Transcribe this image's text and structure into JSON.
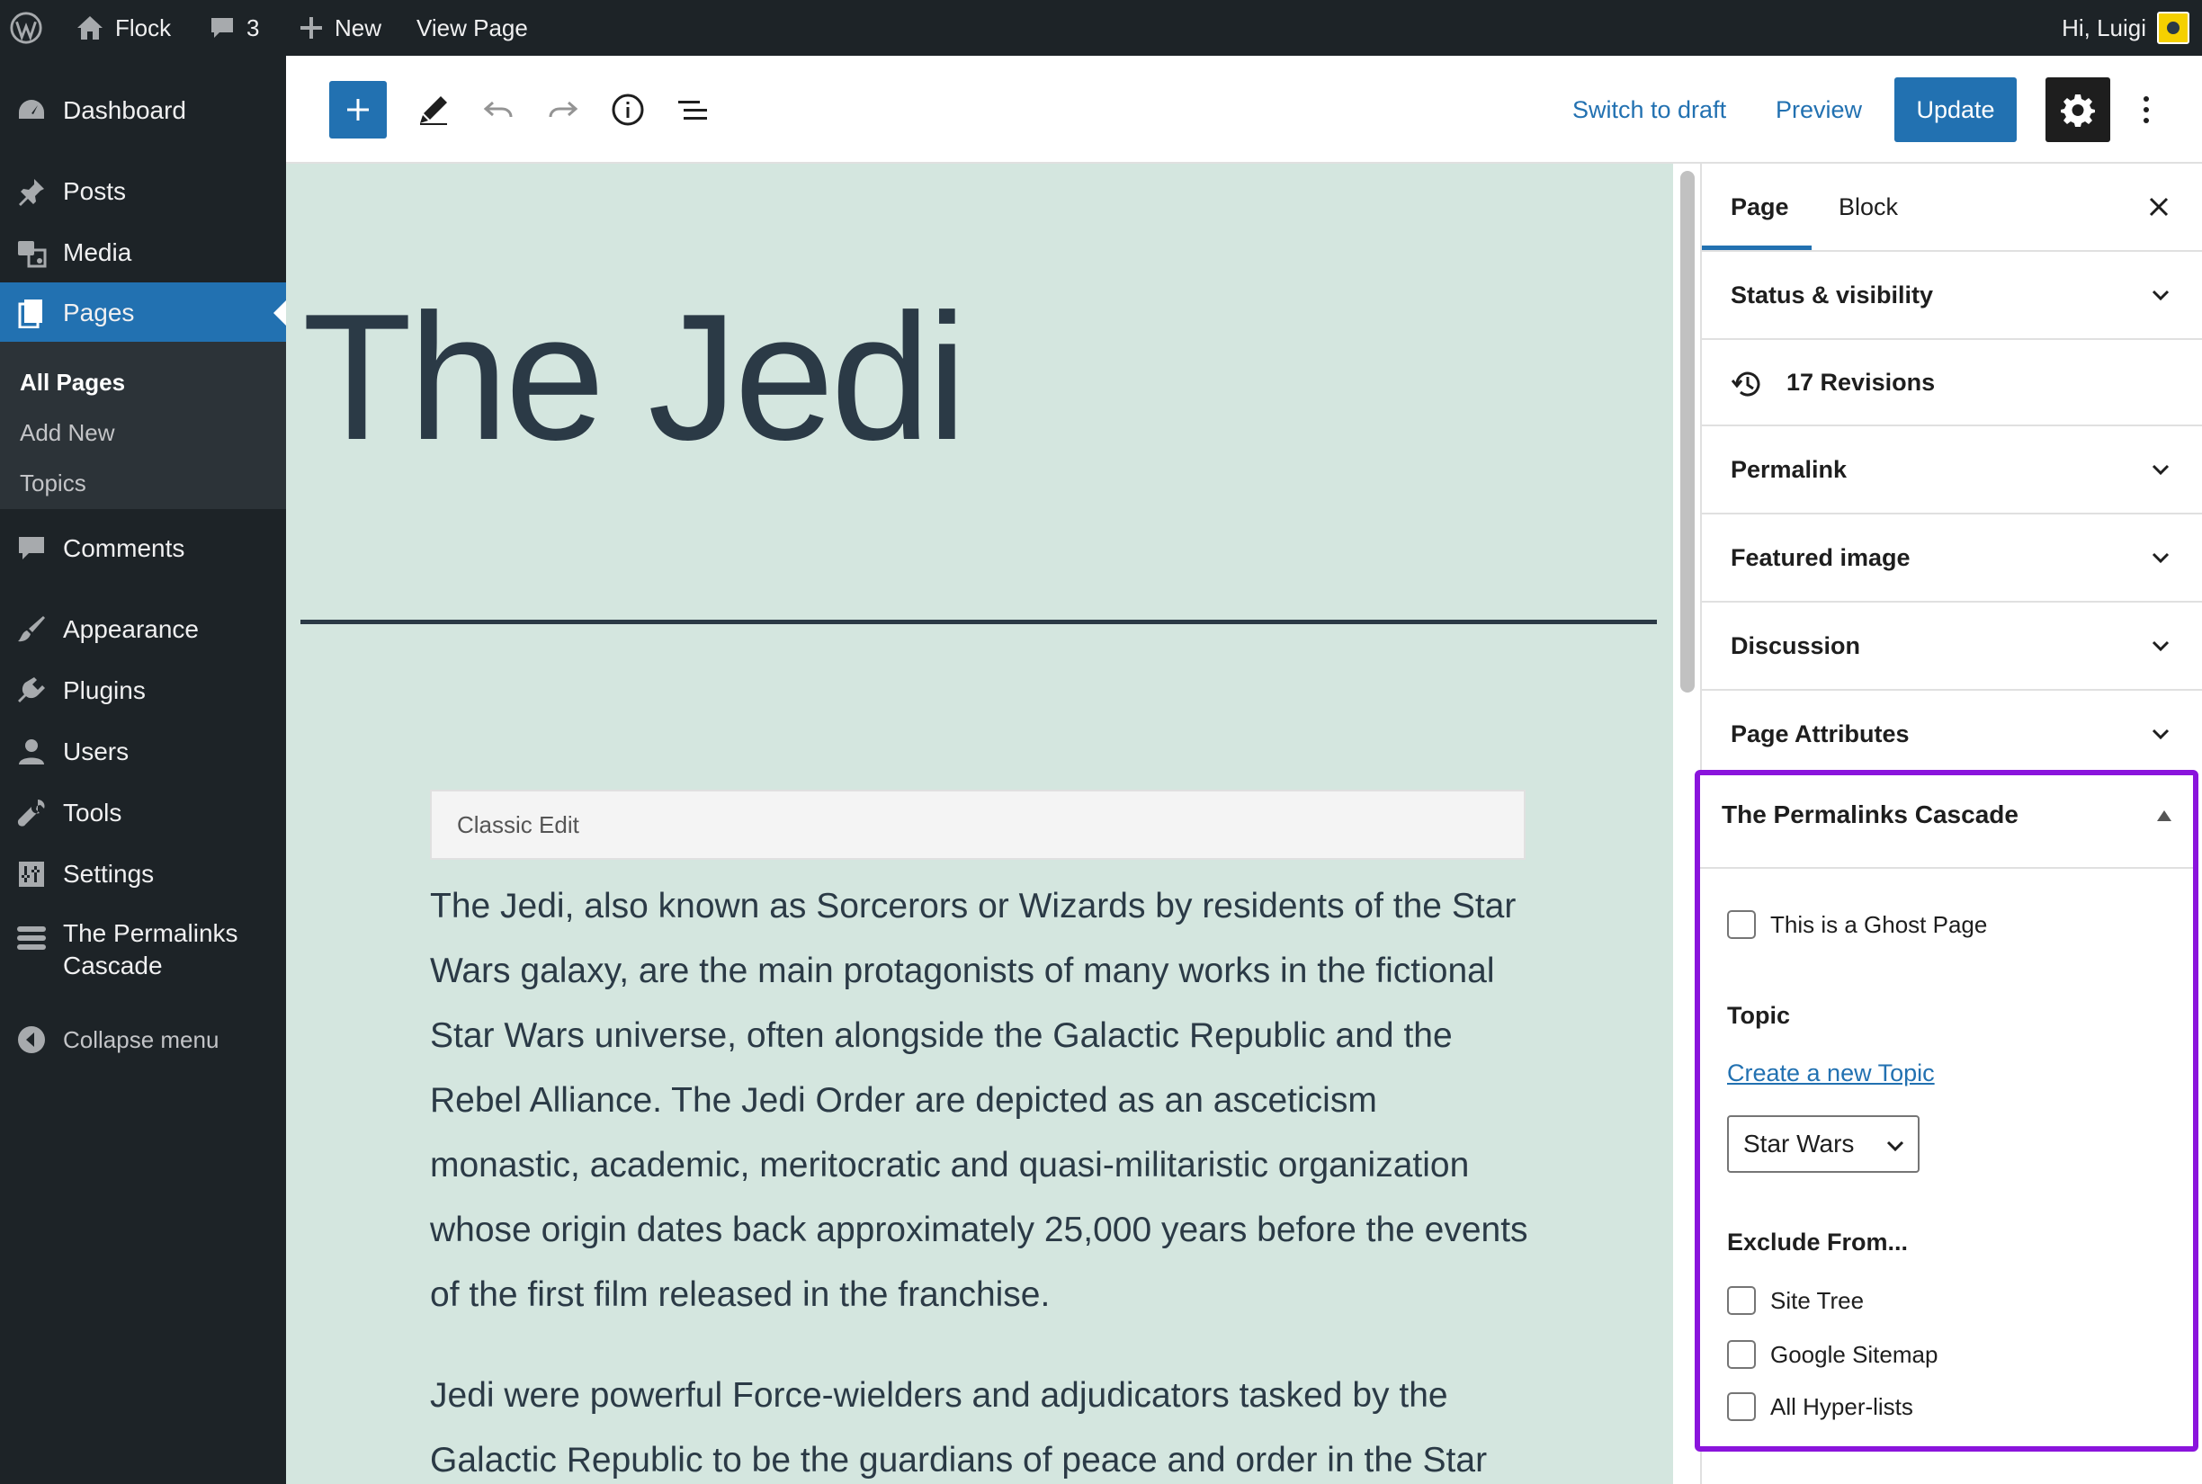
{
  "admin_bar": {
    "site_name": "Flock",
    "comments_count": "3",
    "new_label": "New",
    "view_page_label": "View Page",
    "greeting": "Hi, Luigi"
  },
  "sidebar": {
    "items": [
      {
        "label": "Dashboard",
        "icon": "dashboard-icon"
      },
      {
        "label": "Posts",
        "icon": "pin-icon"
      },
      {
        "label": "Media",
        "icon": "media-icon"
      },
      {
        "label": "Pages",
        "icon": "pages-icon"
      },
      {
        "label": "Comments",
        "icon": "comment-icon"
      },
      {
        "label": "Appearance",
        "icon": "brush-icon"
      },
      {
        "label": "Plugins",
        "icon": "plugin-icon"
      },
      {
        "label": "Users",
        "icon": "user-icon"
      },
      {
        "label": "Tools",
        "icon": "wrench-icon"
      },
      {
        "label": "Settings",
        "icon": "settings-icon"
      },
      {
        "label": "The Permalinks Cascade",
        "icon": "cascade-icon"
      },
      {
        "label": "Collapse menu",
        "icon": "collapse-icon"
      }
    ],
    "submenu": [
      "All Pages",
      "Add New",
      "Topics"
    ],
    "cascade_lines": [
      "The Permalinks",
      "Cascade"
    ]
  },
  "toolbar": {
    "switch_to_draft": "Switch to draft",
    "preview": "Preview",
    "update": "Update"
  },
  "editor": {
    "title": "The Jedi",
    "classic_label": "Classic Edit",
    "paragraph_1": "The Jedi, also known as Sorcerors or Wizards by residents of the Star Wars galaxy, are the main protagonists of many works in the fictional Star Wars universe, often alongside the Galactic Republic and the Rebel Alliance. The Jedi Order are depicted as an asceticism monastic, academic, meritocratic and quasi-militaristic organization whose origin dates back approximately 25,000 years before the events of the first film released in the franchise.",
    "paragraph_2": "Jedi were powerful Force-wielders and adjudicators tasked by the Galactic Republic to be the guardians of peace and order in the Star"
  },
  "panel": {
    "tabs": [
      "Page",
      "Block"
    ],
    "active_tab": "Page",
    "sections": {
      "status": "Status & visibility",
      "revisions": "17 Revisions",
      "permalink": "Permalink",
      "featured_image": "Featured image",
      "discussion": "Discussion",
      "page_attributes": "Page Attributes"
    }
  },
  "metabox": {
    "title": "The Permalinks Cascade",
    "ghost_page_label": "This is a Ghost Page",
    "topic_label": "Topic",
    "create_topic_link": "Create a new Topic",
    "topic_selected": "Star Wars",
    "exclude_label": "Exclude From...",
    "exclude_options": [
      "Site Tree",
      "Google Sitemap",
      "All Hyper-lists"
    ]
  },
  "colors": {
    "admin_dark": "#1d2327",
    "accent": "#2271b1",
    "canvas_bg": "#d4e6df",
    "highlight": "#8a14dc"
  }
}
